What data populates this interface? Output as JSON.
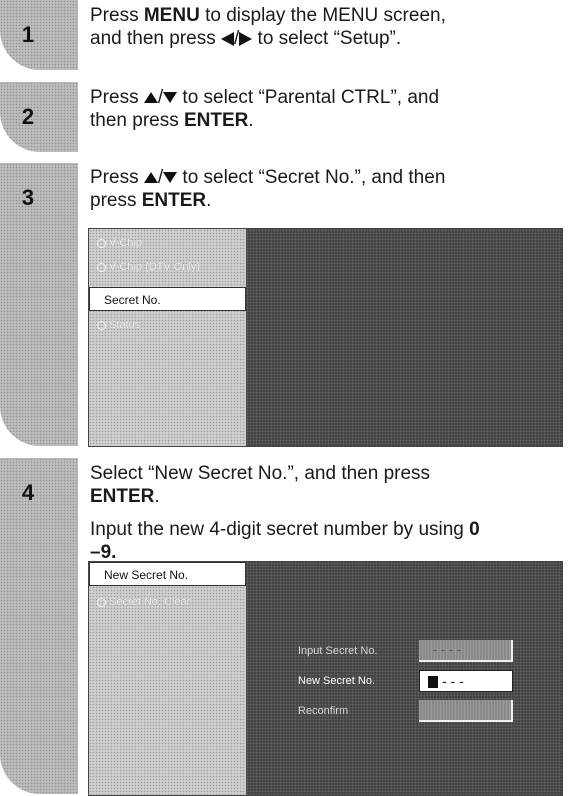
{
  "steps": [
    {
      "number": "1",
      "line1_pre": "Press ",
      "line1_bold": "MENU",
      "line1_post": " to display the MENU screen,",
      "line2_pre": "and then press ",
      "line2_sep": "/",
      "line2_post": " to select “Setup”."
    },
    {
      "number": "2",
      "line1_pre": "Press ",
      "line1_sep": "/",
      "line1_post": " to select “Parental CTRL”, and",
      "line2_pre": "then press ",
      "line2_bold": "ENTER",
      "line2_post": "."
    },
    {
      "number": "3",
      "line1_pre": "Press ",
      "line1_sep": "/",
      "line1_post": " to select “Secret No.”, and then",
      "line2_pre": "press ",
      "line2_bold": "ENTER",
      "line2_post": ".",
      "screen": {
        "menu_items": [
          "V-Chip",
          "V-Chip (DTV Only)",
          "Status"
        ],
        "selected": "Secret No."
      }
    },
    {
      "number": "4",
      "line1": "Select “New Secret No.”, and then press",
      "line2_bold": "ENTER",
      "line2_post": ".",
      "line3_pre": "Input the new 4-digit secret number by using ",
      "line3_bold_a": "0",
      "line4_bold": "–9.",
      "screen": {
        "selected": "New Secret No.",
        "menu_items": [
          "Secret No. Clear"
        ],
        "fields": [
          {
            "label": "Input Secret No.",
            "value": "- - - -"
          },
          {
            "label": "New Secret No.",
            "value": "- - -"
          },
          {
            "label": "Reconfirm",
            "value": ""
          }
        ]
      }
    }
  ]
}
